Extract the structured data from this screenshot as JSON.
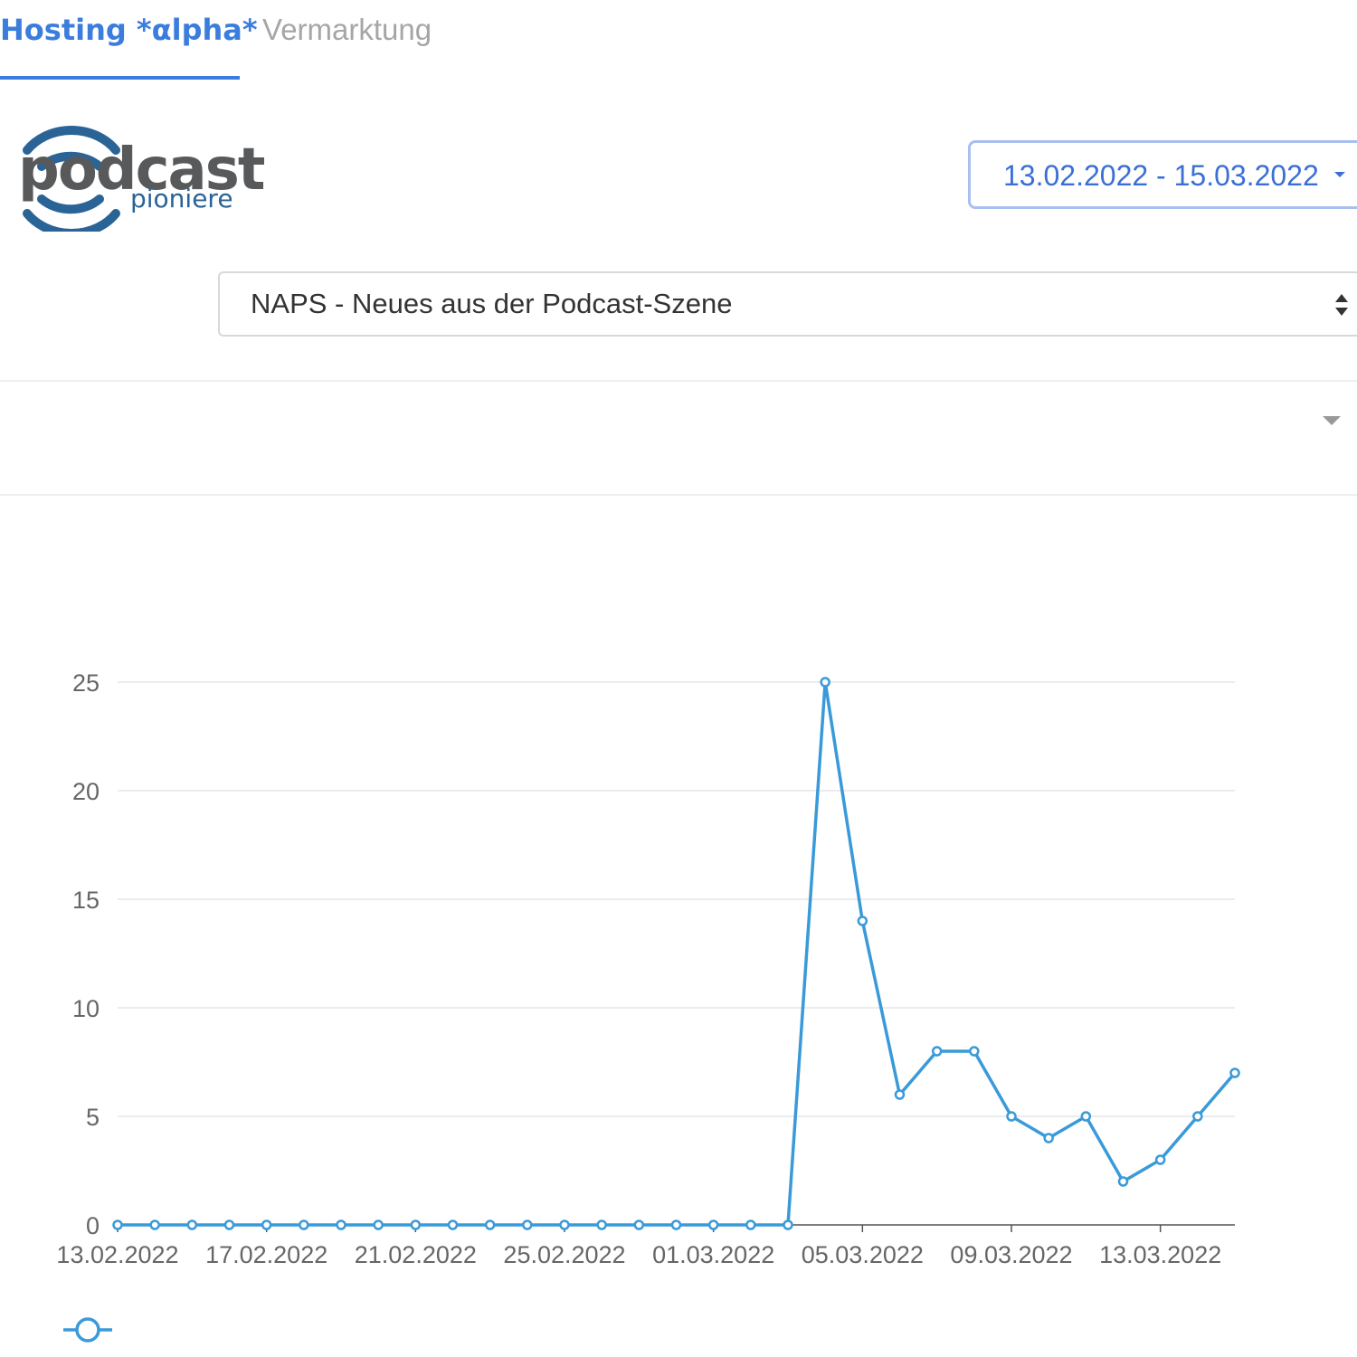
{
  "tabs": [
    {
      "label": "Hosting *αlpha*",
      "active": true
    },
    {
      "label": "Vermarktung",
      "active": false
    }
  ],
  "logo": {
    "line1": "podcast",
    "line2": "pioniere",
    "colors": {
      "gray": "#58595b",
      "blue": "#2a6496"
    }
  },
  "date_range": {
    "value": "13.02.2022 - 15.03.2022",
    "icon": "caret-down-icon"
  },
  "podcast_select": {
    "value": "NAPS - Neues aus der Podcast-Szene",
    "icon": "sort-arrows-icon"
  },
  "filter": {
    "icon": "caret-down-icon"
  },
  "colors": {
    "accent": "#3b7ddd",
    "series": "#3a9ad9"
  },
  "chart_data": {
    "type": "line",
    "x": [
      "13.02.2022",
      "14.02.2022",
      "15.02.2022",
      "16.02.2022",
      "17.02.2022",
      "18.02.2022",
      "19.02.2022",
      "20.02.2022",
      "21.02.2022",
      "22.02.2022",
      "23.02.2022",
      "24.02.2022",
      "25.02.2022",
      "26.02.2022",
      "27.02.2022",
      "28.02.2022",
      "01.03.2022",
      "02.03.2022",
      "03.03.2022",
      "04.03.2022",
      "05.03.2022",
      "06.03.2022",
      "07.03.2022",
      "08.03.2022",
      "09.03.2022",
      "10.03.2022",
      "11.03.2022",
      "12.03.2022",
      "13.03.2022",
      "14.03.2022",
      "15.03.2022"
    ],
    "series": [
      {
        "values": [
          0,
          0,
          0,
          0,
          0,
          0,
          0,
          0,
          0,
          0,
          0,
          0,
          0,
          0,
          0,
          0,
          0,
          0,
          0,
          25,
          14,
          6,
          8,
          8,
          5,
          4,
          5,
          2,
          3,
          5,
          7
        ]
      }
    ],
    "x_tick_labels": [
      "13.02.2022",
      "17.02.2022",
      "21.02.2022",
      "25.02.2022",
      "01.03.2022",
      "05.03.2022",
      "09.03.2022",
      "13.03.2022"
    ],
    "y_ticks": [
      0,
      5,
      10,
      15,
      20,
      25
    ],
    "ylim": [
      0,
      25
    ],
    "grid": true,
    "legend": "bottom-left"
  }
}
